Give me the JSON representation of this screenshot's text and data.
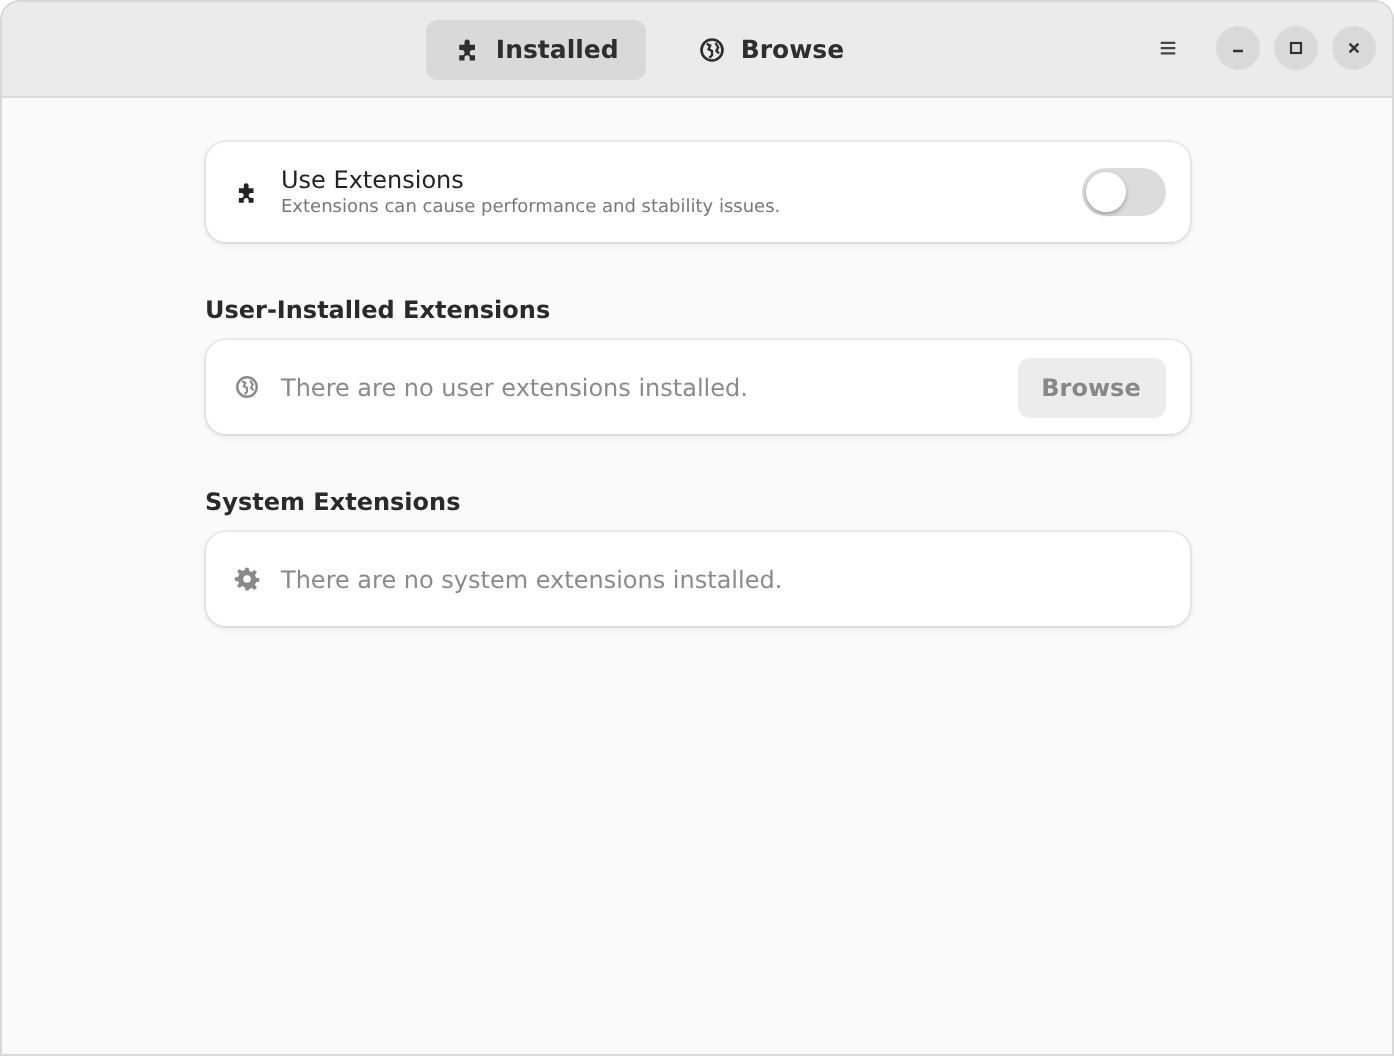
{
  "header": {
    "tabs": [
      {
        "label": "Installed",
        "selected": true
      },
      {
        "label": "Browse",
        "selected": false
      }
    ],
    "menu": "≡"
  },
  "main_setting": {
    "title": "Use Extensions",
    "subtitle": "Extensions can cause performance and stability issues.",
    "on": false
  },
  "sections": [
    {
      "heading": "User-Installed Extensions",
      "message": "There are no user extensions installed.",
      "button": "Browse"
    },
    {
      "heading": "System Extensions",
      "message": "There are no system extensions installed."
    }
  ]
}
